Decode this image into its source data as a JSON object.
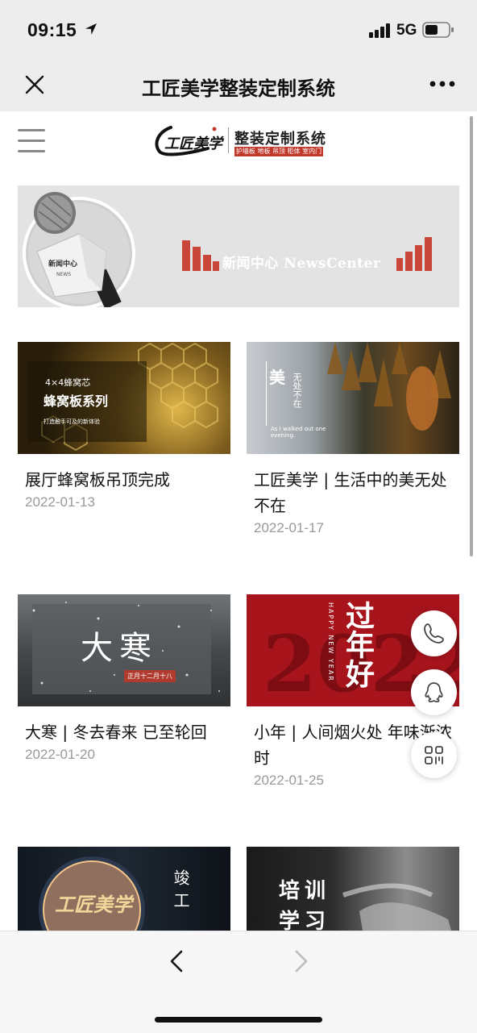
{
  "status_bar": {
    "time": "09:15",
    "network": "5G"
  },
  "nav": {
    "title": "工匠美学整装定制系统"
  },
  "logo": {
    "name": "整装定制系统",
    "tagline": "护墙板 地板 吊顶 柜体 室内门",
    "brand": "工匠美学"
  },
  "banner": {
    "title": "新闻中心 NewsCenter",
    "mic_label": "新闻中心",
    "mic_sub": "NEWS"
  },
  "articles": [
    {
      "title": "展厅蜂窝板吊顶完成",
      "date": "2022-01-13",
      "thumb_line1": "4×4蜂窝芯",
      "thumb_line2": "蜂窝板系列",
      "thumb_line3": "打造触手可及的新体验"
    },
    {
      "title": "工匠美学 | 生活中的美无处不在",
      "date": "2022-01-17",
      "thumb_big": "美",
      "thumb_line1": "无处不在",
      "thumb_line2": "As I walked out one evening."
    },
    {
      "title": "大寒 | 冬去春来 已至轮回",
      "date": "2022-01-20",
      "thumb_big": "大寒",
      "thumb_line1": "正月十二月十八"
    },
    {
      "title": "小年 | 人间烟火处 年味渐浓时",
      "date": "2022-01-25",
      "thumb_big": "过年好",
      "thumb_line1": "HAPPY NEW YEAR"
    },
    {
      "title": "",
      "date": "",
      "thumb_big": "工匠美学",
      "thumb_line1": "竣工"
    },
    {
      "title": "",
      "date": "",
      "thumb_big": "培训学习"
    }
  ],
  "colors": {
    "brand_red": "#c0392b",
    "bar_bg": "#ededed",
    "banner_bg": "#e3e3e3"
  },
  "icons": [
    "close-icon",
    "more-icon",
    "menu-icon",
    "phone-icon",
    "qq-icon",
    "qrcode-icon",
    "back-arrow-icon",
    "forward-arrow-icon"
  ]
}
